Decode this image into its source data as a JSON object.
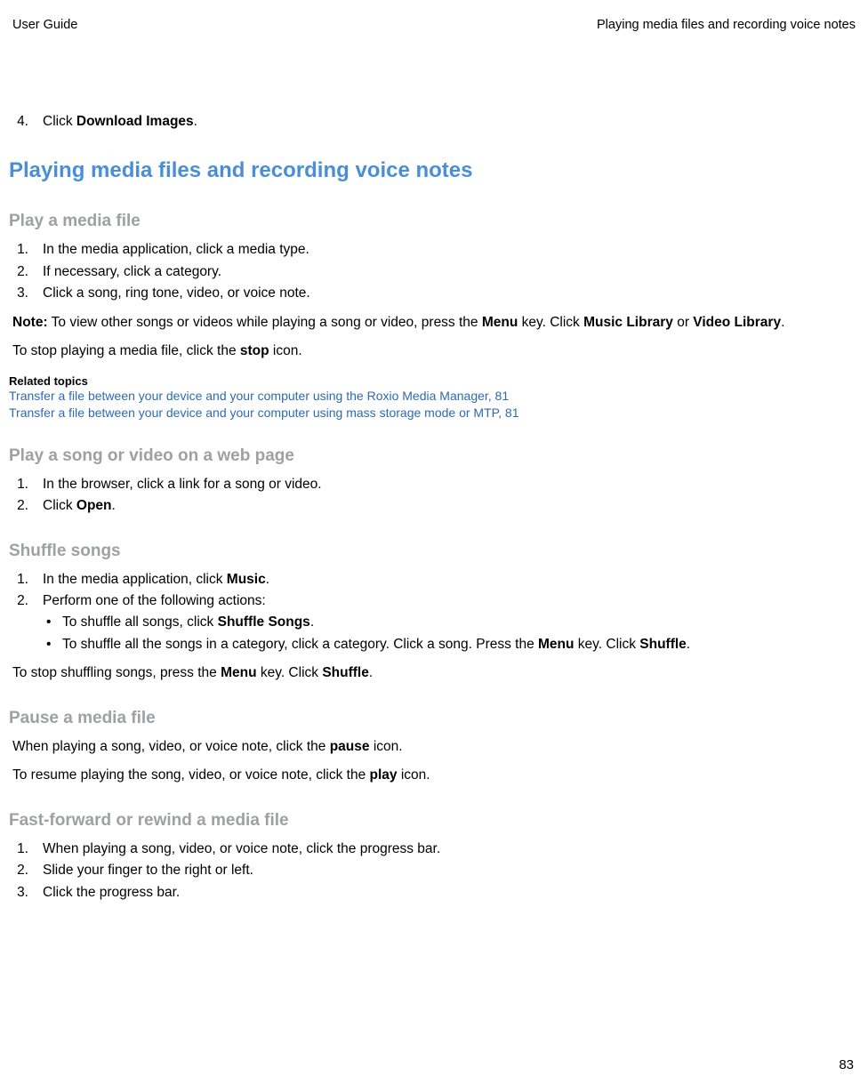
{
  "header": {
    "left": "User Guide",
    "right": "Playing media files and recording voice notes"
  },
  "topStep": {
    "num": "4.",
    "pre": "Click ",
    "bold": "Download Images",
    "post": "."
  },
  "h1": "Playing media files and recording voice notes",
  "playMedia": {
    "title": "Play a media file",
    "steps": [
      {
        "num": "1.",
        "text": "In the media application, click a media type."
      },
      {
        "num": "2.",
        "text": "If necessary, click a category."
      },
      {
        "num": "3.",
        "text": "Click a song, ring tone, video, or voice note."
      }
    ],
    "note": {
      "label": "Note:",
      "p1": "  To view other songs or videos while playing a song or video, press the ",
      "k1": "Menu",
      "p2": " key. Click ",
      "k2": "Music Library",
      "p3": " or ",
      "k3": "Video Library",
      "p4": "."
    },
    "stopLine": {
      "p1": "To stop playing a media file, click the ",
      "k1": "stop",
      "p2": " icon."
    },
    "relatedLabel": "Related topics",
    "links": [
      "Transfer a file between your device and your computer using the Roxio Media Manager, 81",
      "Transfer a file between your device and your computer using mass storage mode or MTP, 81"
    ]
  },
  "webPage": {
    "title": "Play a song or video on a web page",
    "steps": [
      {
        "num": "1.",
        "text": "In the browser, click a link for a song or video."
      },
      {
        "num": "2.",
        "pre": "Click ",
        "bold": "Open",
        "post": "."
      }
    ]
  },
  "shuffle": {
    "title": "Shuffle songs",
    "steps": [
      {
        "num": "1.",
        "pre": "In the media application, click ",
        "bold": "Music",
        "post": "."
      },
      {
        "num": "2.",
        "text": "Perform one of the following actions:"
      }
    ],
    "bullets": [
      {
        "pre": "To shuffle all songs, click ",
        "bold": "Shuffle Songs",
        "post": "."
      },
      {
        "pre": "To shuffle all the songs in a category, click a category. Click a song. Press the ",
        "k1": "Menu",
        "mid": " key. Click ",
        "k2": "Shuffle",
        "post": "."
      }
    ],
    "stopLine": {
      "p1": "To stop shuffling songs, press the ",
      "k1": "Menu",
      "p2": " key. Click ",
      "k2": "Shuffle",
      "p3": "."
    }
  },
  "pause": {
    "title": "Pause a media file",
    "line1": {
      "p1": "When playing a song, video, or voice note, click the ",
      "k1": "pause",
      "p2": " icon."
    },
    "line2": {
      "p1": "To resume playing the song, video, or voice note, click the ",
      "k1": "play",
      "p2": " icon."
    }
  },
  "ff": {
    "title": "Fast-forward or rewind a media file",
    "steps": [
      {
        "num": "1.",
        "text": "When playing a song, video, or voice note, click the progress bar."
      },
      {
        "num": "2.",
        "text": "Slide your finger to the right or left."
      },
      {
        "num": "3.",
        "text": "Click the progress bar."
      }
    ]
  },
  "pageNumber": "83"
}
